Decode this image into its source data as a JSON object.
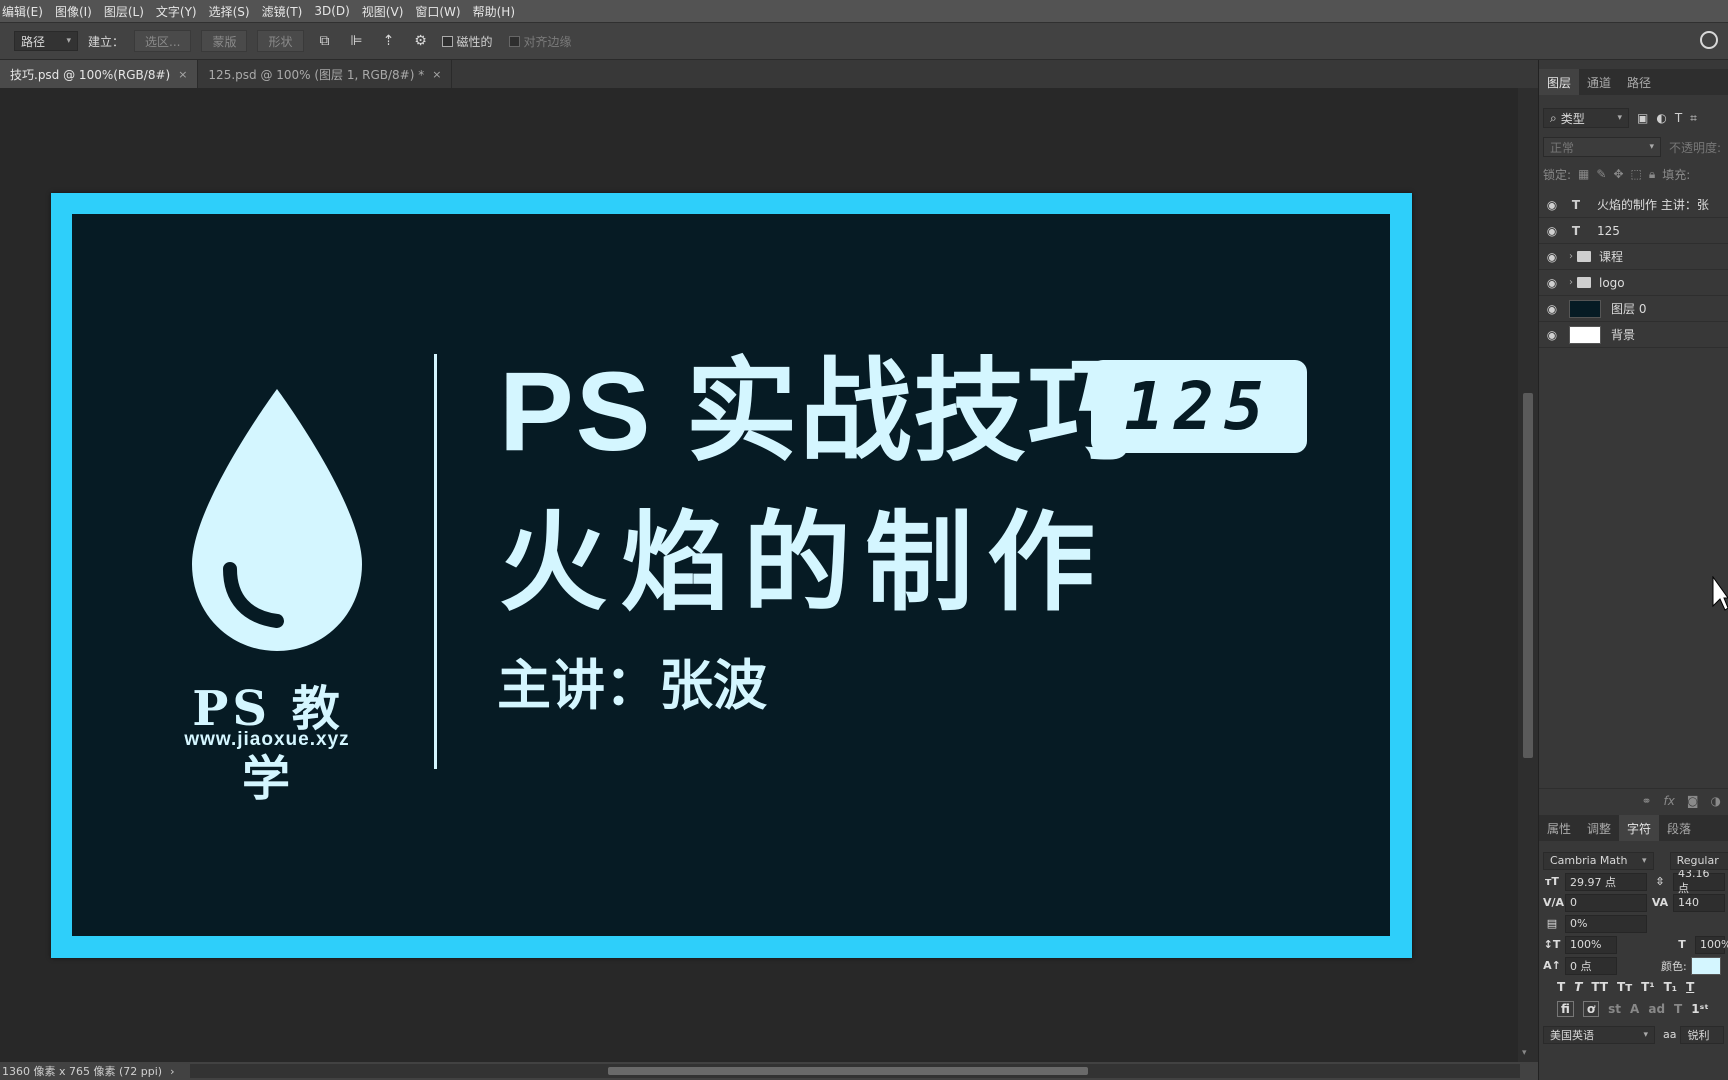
{
  "menu": [
    "编辑(E)",
    "图像(I)",
    "图层(L)",
    "文字(Y)",
    "选择(S)",
    "滤镜(T)",
    "3D(D)",
    "视图(V)",
    "窗口(W)",
    "帮助(H)"
  ],
  "options": {
    "mode_select": "路径",
    "make_label": "建立：",
    "selection_btn": "选区...",
    "mask_btn": "蒙版",
    "shape_btn": "形状",
    "magnetic_label": "磁性的",
    "align_edges_label": "对齐边缘"
  },
  "tabs": [
    {
      "label": "技巧.psd @ 100%(RGB/8#)",
      "close": "×"
    },
    {
      "label": "125.psd @ 100% (图层 1, RGB/8#) *",
      "close": "×"
    }
  ],
  "canvas": {
    "logo_text": "PS 教学",
    "logo_url": "www.jiaoxue.xyz",
    "title": "PS 实战技巧",
    "badge": "125",
    "subtitle": "火焰的制作",
    "speaker": "主讲：张波",
    "colors": {
      "frame": "#2ecffa",
      "background": "#061b24",
      "foreground": "#d4f6ff"
    }
  },
  "status": {
    "doc_size": "1360 像素 x 765 像素 (72 ppi)",
    "arrow": "›"
  },
  "layers_panel": {
    "tabs": [
      "图层",
      "通道",
      "路径"
    ],
    "filter": "类型",
    "blend_mode": "正常",
    "opacity_label": "不透明度:",
    "lock_label": "锁定:",
    "fill_label": "填充:",
    "layers": [
      {
        "name": "火焰的制作 主讲：张",
        "kind": "T"
      },
      {
        "name": "125",
        "kind": "T"
      },
      {
        "name": "课程",
        "kind": "folder"
      },
      {
        "name": "logo",
        "kind": "folder"
      },
      {
        "name": "图层 0",
        "kind": "image",
        "thumb_color": "#061b24"
      },
      {
        "name": "背景",
        "kind": "image",
        "thumb_color": "#ffffff"
      }
    ]
  },
  "props_panel": {
    "tabs": [
      "属性",
      "调整",
      "字符",
      "段落"
    ],
    "font_family": "Cambria Math",
    "font_style": "Regular",
    "font_size": "29.97 点",
    "leading": "43.16 点",
    "kerning": "0",
    "tracking": "140",
    "scale_pct": "0%",
    "vscale": "100%",
    "hscale": "100%",
    "baseline": "0 点",
    "color_label": "颜色:",
    "language": "美国英语",
    "antialias_label": "aa",
    "antialias": "锐利",
    "text_color": "#d4f6ff"
  }
}
